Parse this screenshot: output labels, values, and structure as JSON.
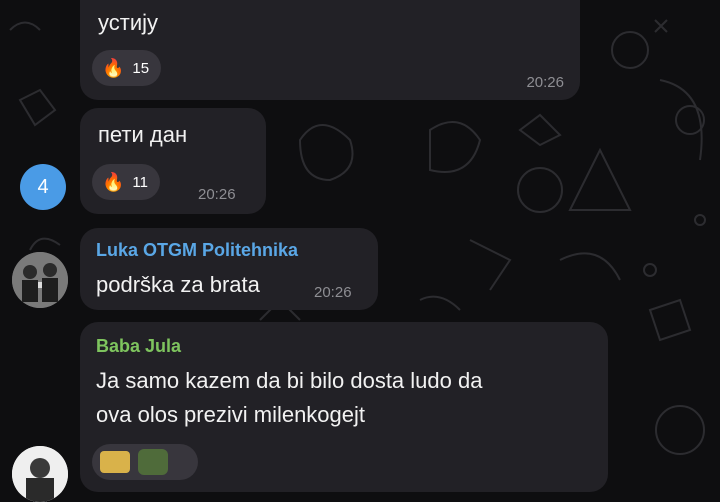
{
  "messages": [
    {
      "text": "устију",
      "reaction": {
        "icon": "fire-emoji-icon",
        "count": "15"
      },
      "time": "20:26"
    },
    {
      "text": "пети дан",
      "reaction": {
        "icon": "fire-emoji-icon",
        "count": "11"
      },
      "time": "20:26"
    },
    {
      "sender": "Luka OTGM Politehnika",
      "sender_color": "#5aa7e6",
      "text": "podrška za brata",
      "time": "20:26"
    },
    {
      "sender": "Baba Jula",
      "sender_color": "#7ec45e",
      "text_lines": [
        "Ja samo kazem da bi bilo dosta ludo da",
        "ova olos prezivi milenkogejt"
      ]
    }
  ],
  "unread_badge": {
    "count": "4",
    "color": "#4a9be6"
  },
  "colors": {
    "background": "#0e0e10",
    "bubble": "#222126",
    "reaction": "#38363d"
  }
}
